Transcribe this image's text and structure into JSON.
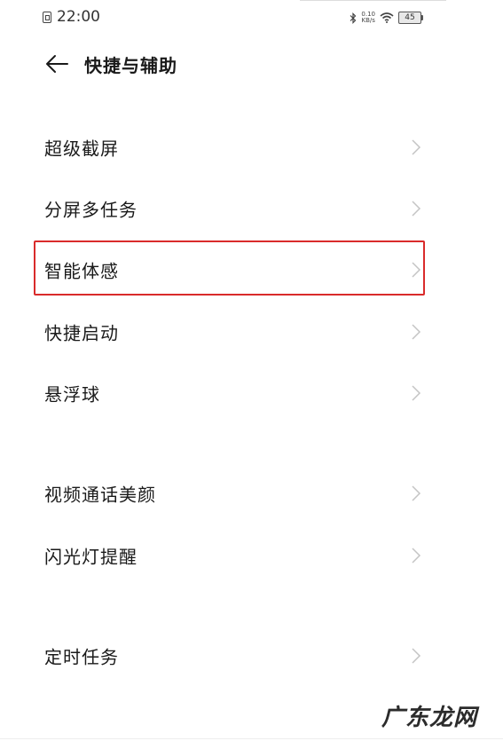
{
  "status_bar": {
    "time": "22:00",
    "net_speed_value": "0.10",
    "net_speed_unit": "KB/s",
    "battery": "45"
  },
  "header": {
    "title": "快捷与辅助"
  },
  "items": [
    {
      "label": "超级截屏"
    },
    {
      "label": "分屏多任务"
    },
    {
      "label": "智能体感"
    },
    {
      "label": "快捷启动"
    },
    {
      "label": "悬浮球"
    },
    {
      "label": "视频通话美颜"
    },
    {
      "label": "闪光灯提醒"
    },
    {
      "label": "定时任务"
    }
  ],
  "watermark": "广东龙网",
  "colors": {
    "highlight": "#d92b2b",
    "chevron": "#c4c4c4",
    "text": "#1a1a1a"
  }
}
